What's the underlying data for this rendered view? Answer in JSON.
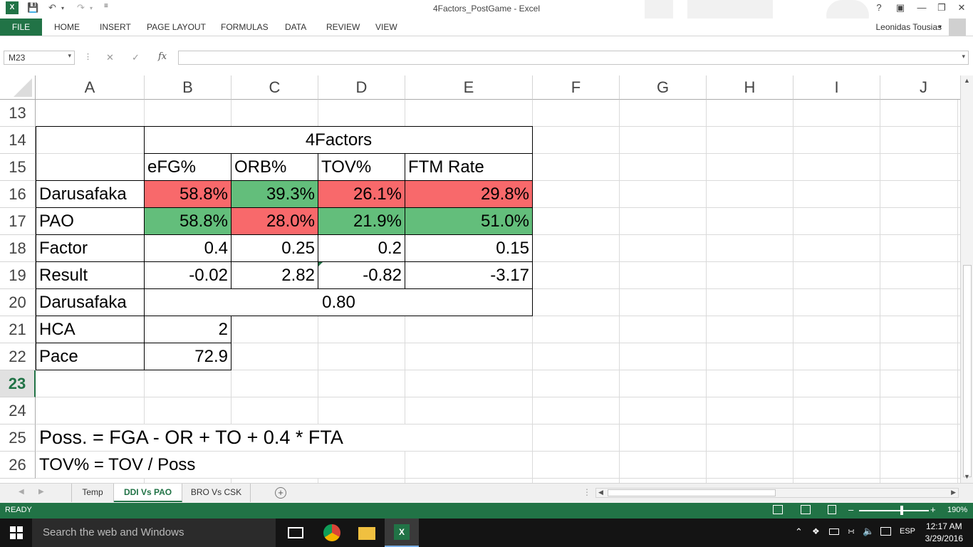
{
  "window": {
    "title": "4Factors_PostGame - Excel",
    "help": "?",
    "user": "Leonidas Tousias"
  },
  "ribbon": {
    "tabs": [
      "FILE",
      "HOME",
      "INSERT",
      "PAGE LAYOUT",
      "FORMULAS",
      "DATA",
      "REVIEW",
      "VIEW"
    ]
  },
  "formula_bar": {
    "name_box": "M23",
    "fx_label": "fx",
    "formula": ""
  },
  "columns": [
    "A",
    "B",
    "C",
    "D",
    "E",
    "F",
    "G",
    "H",
    "I",
    "J"
  ],
  "rows": [
    "13",
    "14",
    "15",
    "16",
    "17",
    "18",
    "19",
    "20",
    "21",
    "22",
    "23",
    "24",
    "25",
    "26"
  ],
  "selected_row": "23",
  "table": {
    "header": "4Factors",
    "factor_labels": [
      "eFG%",
      "ORB%",
      "TOV%",
      "FTM Rate"
    ],
    "teams": [
      {
        "name": "Darusafaka",
        "values": [
          "58.8%",
          "39.3%",
          "26.1%",
          "29.8%"
        ],
        "highlight": [
          "bad",
          "good",
          "bad",
          "bad"
        ]
      },
      {
        "name": "PAO",
        "values": [
          "58.8%",
          "28.0%",
          "21.9%",
          "51.0%"
        ],
        "highlight": [
          "good",
          "bad",
          "good",
          "good"
        ]
      }
    ],
    "factor_row": {
      "label": "Factor",
      "values": [
        "0.4",
        "0.25",
        "0.2",
        "0.15"
      ]
    },
    "result_row": {
      "label": "Result",
      "values": [
        "-0.02",
        "2.82",
        "-0.82",
        "-3.17"
      ]
    },
    "winner_row": {
      "label": "Darusafaka",
      "value": "0.80"
    },
    "hca": {
      "label": "HCA",
      "value": "2"
    },
    "pace": {
      "label": "Pace",
      "value": "72.9"
    }
  },
  "notes": {
    "poss_formula": "Poss. = FGA - OR + TO + 0.4 * FTA",
    "tov_formula": "TOV% = TOV / Poss"
  },
  "colors": {
    "excel_green": "#217346",
    "cond_red": "#f8696b",
    "cond_green": "#63be7b"
  },
  "sheets": {
    "tabs": [
      "Temp",
      "DDI Vs PAO",
      "BRO Vs CSK"
    ],
    "active": "DDI Vs PAO"
  },
  "status": {
    "mode": "READY",
    "zoom": "190%",
    "zoom_level": 0.6
  },
  "taskbar": {
    "search_placeholder": "Search the web and Windows",
    "lang": "ESP",
    "time": "12:17 AM",
    "date": "3/29/2016"
  }
}
